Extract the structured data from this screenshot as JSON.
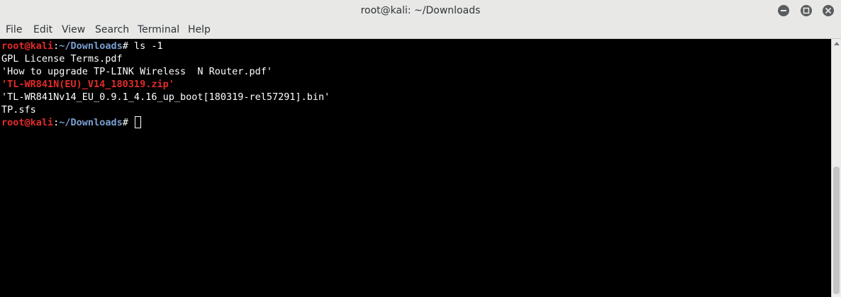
{
  "window": {
    "title": "root@kali: ~/Downloads"
  },
  "menu": {
    "items": [
      "File",
      "Edit",
      "View",
      "Search",
      "Terminal",
      "Help"
    ]
  },
  "terminal": {
    "prompt_user": "root@kali",
    "prompt_sep": ":",
    "prompt_path": "~/Downloads",
    "prompt_symbol": "# ",
    "command": "ls -1",
    "output": [
      {
        "text": "GPL License Terms.pdf",
        "style": "normal"
      },
      {
        "text": "'How to upgrade TP-LINK Wireless  N Router.pdf'",
        "style": "normal"
      },
      {
        "text": "'TL-WR841N(EU)_V14_180319.zip'",
        "style": "archive"
      },
      {
        "text": "'TL-WR841Nv14_EU_0.9.1_4.16_up_boot[180319-rel57291].bin'",
        "style": "normal"
      },
      {
        "text": "TP.sfs",
        "style": "normal"
      }
    ]
  },
  "colors": {
    "prompt_user": "#e52a2a",
    "prompt_path": "#7a9fd1",
    "archive_file": "#e52a2a",
    "background": "#000000",
    "text": "#ffffff"
  },
  "icons": {
    "minimize": "minimize-icon",
    "maximize": "maximize-icon",
    "close": "close-icon",
    "scroll_up": "arrow-up-icon"
  }
}
